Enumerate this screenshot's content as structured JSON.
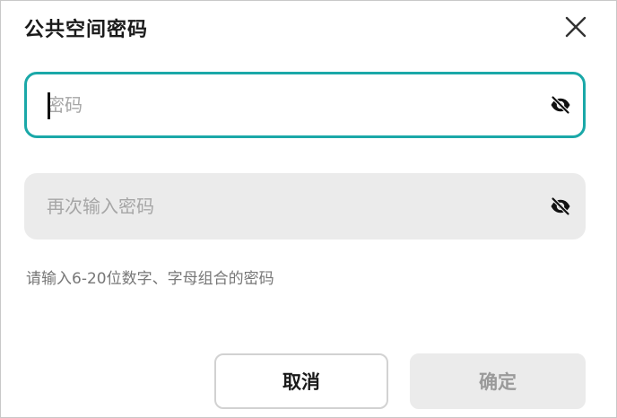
{
  "dialog": {
    "title": "公共空间密码",
    "close_icon": "close-icon"
  },
  "password_field": {
    "value": "",
    "placeholder": "密码",
    "toggle_icon": "eye-off-icon",
    "focused": true,
    "border_color": "#1aa8a8"
  },
  "confirm_field": {
    "value": "",
    "placeholder": "再次输入密码",
    "toggle_icon": "eye-off-icon"
  },
  "hint": {
    "text": "请输入6-20位数字、字母组合的密码"
  },
  "buttons": {
    "cancel_label": "取消",
    "confirm_label": "确定"
  },
  "colors": {
    "accent": "#1aa8a8",
    "disabled_bg": "#ebebeb",
    "disabled_text": "#9a9a9a"
  }
}
